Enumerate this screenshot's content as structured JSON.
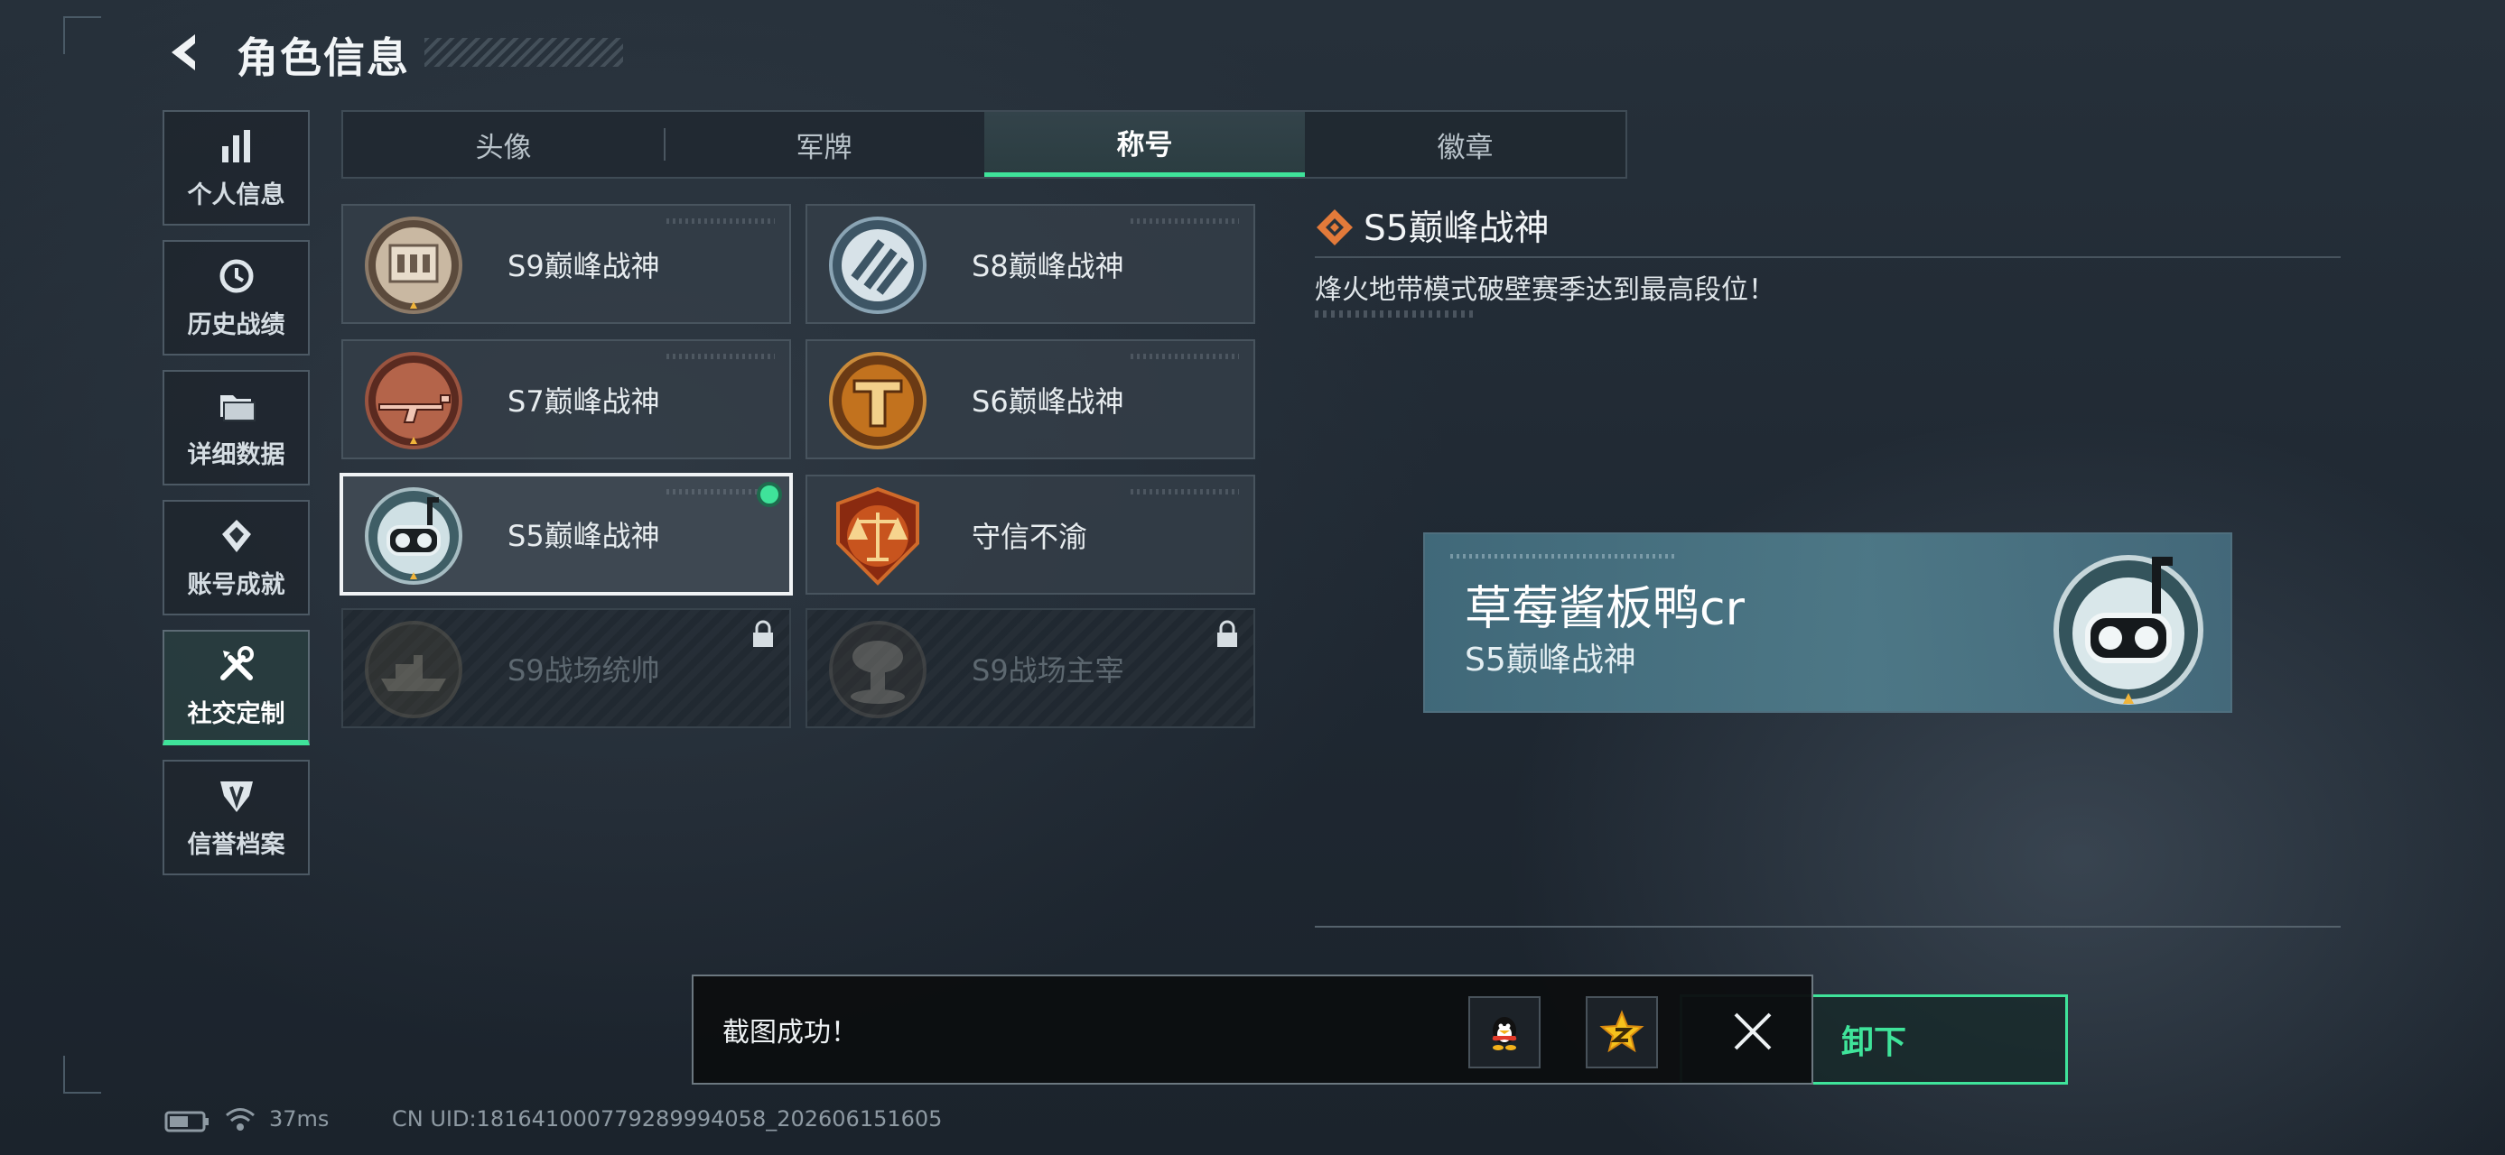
{
  "header": {
    "title": "角色信息"
  },
  "sidebar": {
    "items": [
      {
        "label": "个人信息",
        "icon": "bar-chart-icon",
        "active": false
      },
      {
        "label": "历史战绩",
        "icon": "history-clock-icon",
        "active": false
      },
      {
        "label": "详细数据",
        "icon": "folder-icon",
        "active": false
      },
      {
        "label": "账号成就",
        "icon": "achievement-icon",
        "active": false
      },
      {
        "label": "社交定制",
        "icon": "tools-icon",
        "active": true
      },
      {
        "label": "信誉档案",
        "icon": "credit-shield-icon",
        "active": false
      }
    ]
  },
  "tabs": [
    {
      "label": "头像",
      "active": false
    },
    {
      "label": "军牌",
      "active": false
    },
    {
      "label": "称号",
      "active": true
    },
    {
      "label": "徽章",
      "active": false
    }
  ],
  "titles": [
    {
      "label": "S9巅峰战神",
      "icon": "building-emblem-icon",
      "state": "available"
    },
    {
      "label": "S8巅峰战神",
      "icon": "striped-emblem-icon",
      "state": "available"
    },
    {
      "label": "S7巅峰战神",
      "icon": "rifle-emblem-icon",
      "state": "available"
    },
    {
      "label": "S6巅峰战神",
      "icon": "t-emblem-icon",
      "state": "available"
    },
    {
      "label": "S5巅峰战神",
      "icon": "diver-mask-emblem-icon",
      "state": "selected-equipped"
    },
    {
      "label": "守信不渝",
      "icon": "scales-emblem-icon",
      "state": "available"
    },
    {
      "label": "S9战场统帅",
      "icon": "warship-emblem-icon",
      "state": "locked"
    },
    {
      "label": "S9战场主宰",
      "icon": "mushroom-cloud-emblem-icon",
      "state": "locked"
    }
  ],
  "detail": {
    "title": "S5巅峰战神",
    "description": "烽火地带模式破壁赛季达到最高段位！"
  },
  "preview": {
    "player_name": "草莓酱板鸭cr",
    "title": "S5巅峰战神"
  },
  "unequip_button": {
    "label": "卸下"
  },
  "toast": {
    "message": "截图成功！",
    "share_targets": [
      "qq-penguin-icon",
      "qzone-star-icon"
    ]
  },
  "status_bar": {
    "ping": "37ms",
    "uid": "CN UID:1816410007792899940​58_202606151605"
  },
  "colors": {
    "accent": "#3fe39a",
    "preview_bg": "#4f7d8c",
    "brand_orange": "#e27a3a"
  }
}
